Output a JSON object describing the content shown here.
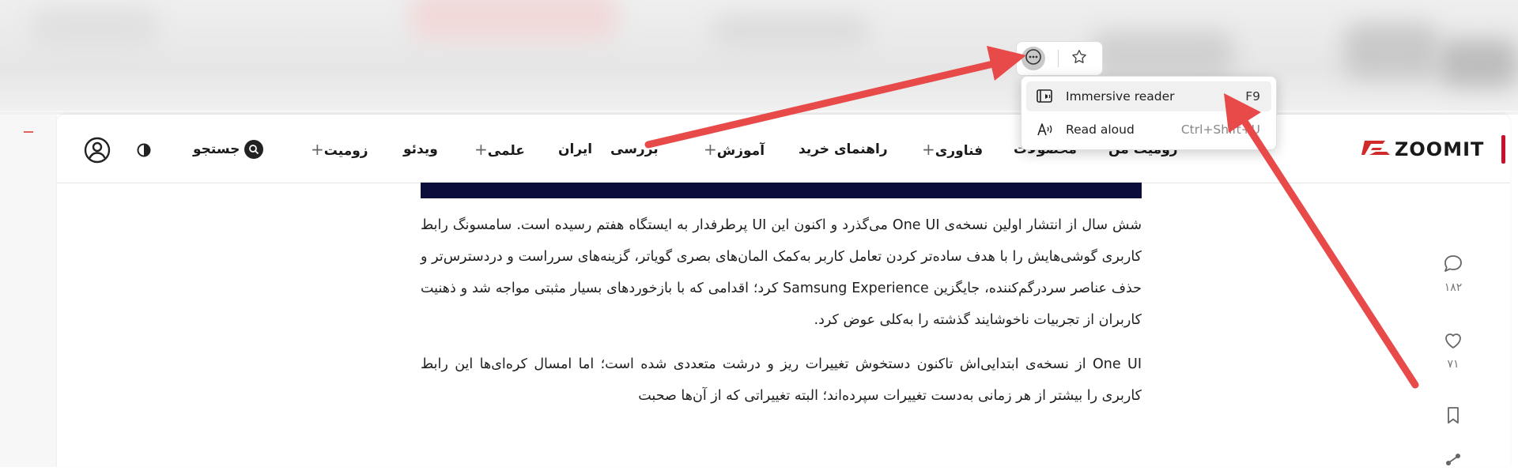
{
  "browser": {
    "more_button_icon": "ellipsis-circle-icon",
    "favorite_icon": "star-outline-icon"
  },
  "menu": {
    "items": [
      {
        "label": "Immersive reader",
        "shortcut": "F9",
        "icon": "immersive-reader-icon"
      },
      {
        "label": "Read aloud",
        "shortcut": "Ctrl+Shift+U",
        "icon": "read-aloud-icon"
      }
    ]
  },
  "site": {
    "logo": "ZOOMIT",
    "nav": {
      "my_zoomit": "زومیت من",
      "products": "محصولات",
      "tech": "فناوری",
      "buying_guide": "راهنمای خرید",
      "education": "آموزش",
      "review": "بررسی",
      "iran": "ایران",
      "science": "علمی",
      "video": "ویدئو",
      "zoomit": "زومیت",
      "search": "جستجو"
    },
    "plus_symbol": "+"
  },
  "article": {
    "paragraphs": [
      "شش سال از انتشار اولین نسخه‌ی One UI می‌گذرد و اکنون این UI پرطرفدار به ایستگاه هفتم رسیده است. سامسونگ رابط کاربری گوشی‌هایش را با هدف ساده‌تر کردن تعامل کاربر به‌کمک المان‌های بصری گویاتر، گزینه‌های سرراست و دردسترس‌تر و حذف عناصر سردرگم‌کننده، جایگزین Samsung Experience کرد؛ اقدامی که با بازخوردهای بسیار مثبتی مواجه شد و ذهنیت کاربران از تجربیات ناخوشایند گذشته را به‌کلی عوض کرد.",
      "One UI از نسخه‌ی ابتدایی‌اش تاکنون دستخوش تغییرات ریز و درشت متعددی شده است؛ اما امسال کره‌ای‌ها این رابط کاربری را بیشتر از هر زمانی به‌دست تغییرات سپرده‌اند؛ البته تغییراتی که از آن‌ها صحبت"
    ]
  },
  "sidebar": {
    "comments_count": "۱۸۲",
    "likes_count": "۷۱"
  },
  "colors": {
    "annotation_red": "#e84a4a",
    "brand_red": "#c8102e",
    "hero_navy": "#0b0d3a"
  }
}
